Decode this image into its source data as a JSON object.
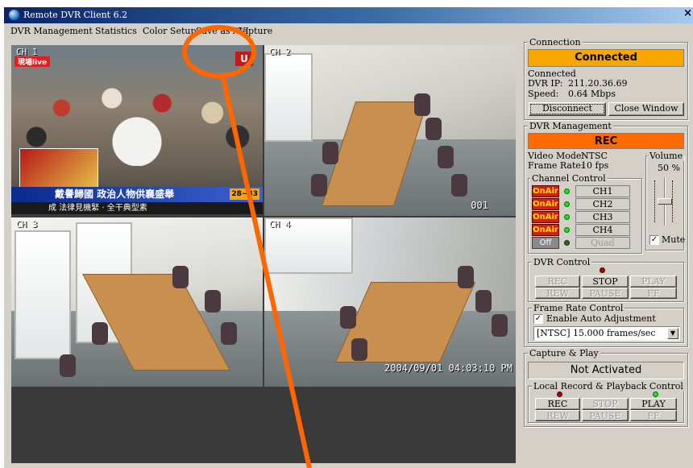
{
  "window": {
    "title": "Remote DVR Client 6.2",
    "close_glyph": "×"
  },
  "menu": [
    "DVR Management",
    "Statistics",
    "Color Setup",
    "Save as AVI",
    "Capture"
  ],
  "feeds": {
    "ch1": {
      "label": "CH 1",
      "live_tag": "現場live",
      "logo": "U",
      "banner": "戴譽歸國  政治人物供襄盛舉",
      "temp": "28~33",
      "ticker": "成 法律見機緊 · 全干典型素"
    },
    "ch2": {
      "label": "CH 2",
      "osd": "001"
    },
    "ch3": {
      "label": "CH 3"
    },
    "ch4": {
      "label": "CH 4",
      "timestamp": "2004/09/01 04:03:10 PM"
    }
  },
  "connection": {
    "group_title": "Connection",
    "status": "Connected",
    "state_text": "Connected",
    "ip_label": "DVR IP:",
    "ip": "211.20.36.69",
    "speed_label": "Speed:",
    "speed": "0.64 Mbps",
    "disconnect_label": "Disconnect",
    "close_label": "Close Window"
  },
  "dvr_management": {
    "group_title": "DVR Management",
    "status": "REC",
    "video_mode_label": "Video Mode:",
    "video_mode": "NTSC",
    "frame_rate_label": "Frame Rate:",
    "frame_rate": "10 fps",
    "volume_label": "Volume",
    "volume_value": "50 %",
    "volume_level": 0.5,
    "mute_label": "Mute",
    "mute_checked": true,
    "channel_control": {
      "group_title": "Channel Control",
      "channels": [
        {
          "state": "OnAir",
          "name": "CH1"
        },
        {
          "state": "OnAir",
          "name": "CH2"
        },
        {
          "state": "OnAir",
          "name": "CH3"
        },
        {
          "state": "OnAir",
          "name": "CH4"
        },
        {
          "state": "Off",
          "name": "Quad"
        }
      ]
    },
    "dvr_control": {
      "group_title": "DVR Control",
      "buttons": [
        "REC",
        "STOP",
        "PLAY",
        "REW",
        "PAUSE",
        "FF"
      ]
    },
    "frame_rate_control": {
      "group_title": "Frame Rate Control",
      "auto_label": "Enable Auto Adjustment",
      "auto_checked": true,
      "selected": "[NTSC] 15.000 frames/sec"
    }
  },
  "capture_play": {
    "group_title": "Capture & Play",
    "status": "Not Activated",
    "local_group_title": "Local Record & Playback Control",
    "buttons": [
      "REC",
      "STOP",
      "PLAY",
      "REW",
      "PAUSE",
      "FF"
    ]
  },
  "colors": {
    "accent_orange": "#f7a600",
    "rec_orange": "#ff6a00",
    "annotation": "#ff6600",
    "title_blue": "#0a246a"
  }
}
